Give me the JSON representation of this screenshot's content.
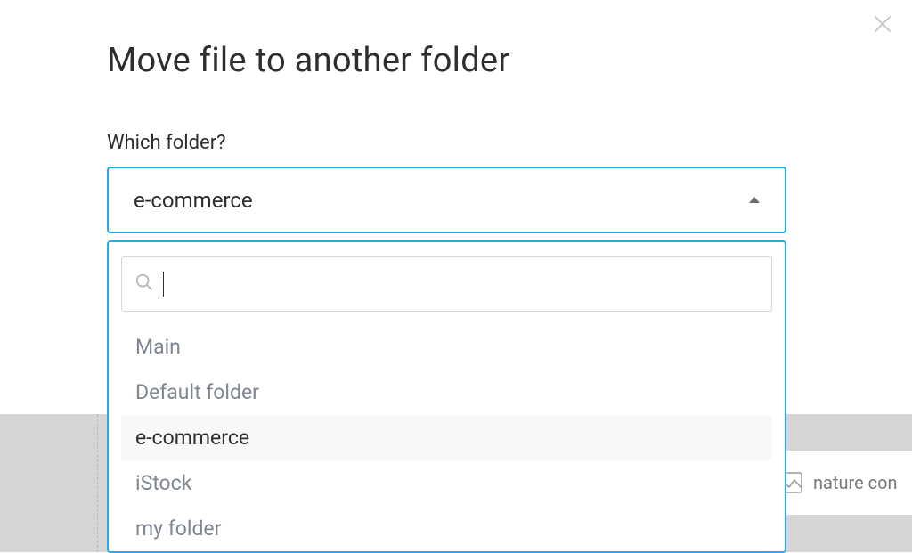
{
  "modal": {
    "title": "Move file to another folder",
    "field_label": "Which folder?",
    "selected_value": "e-commerce",
    "search_value": "",
    "options": [
      {
        "label": "Main",
        "selected": false
      },
      {
        "label": "Default folder",
        "selected": false
      },
      {
        "label": "e-commerce",
        "selected": true
      },
      {
        "label": "iStock",
        "selected": false
      },
      {
        "label": "my folder",
        "selected": false
      }
    ]
  },
  "background": {
    "card_label": "nature con"
  },
  "colors": {
    "accent": "#21aee5",
    "text_primary": "#2e2e2e",
    "text_muted": "#808690"
  }
}
